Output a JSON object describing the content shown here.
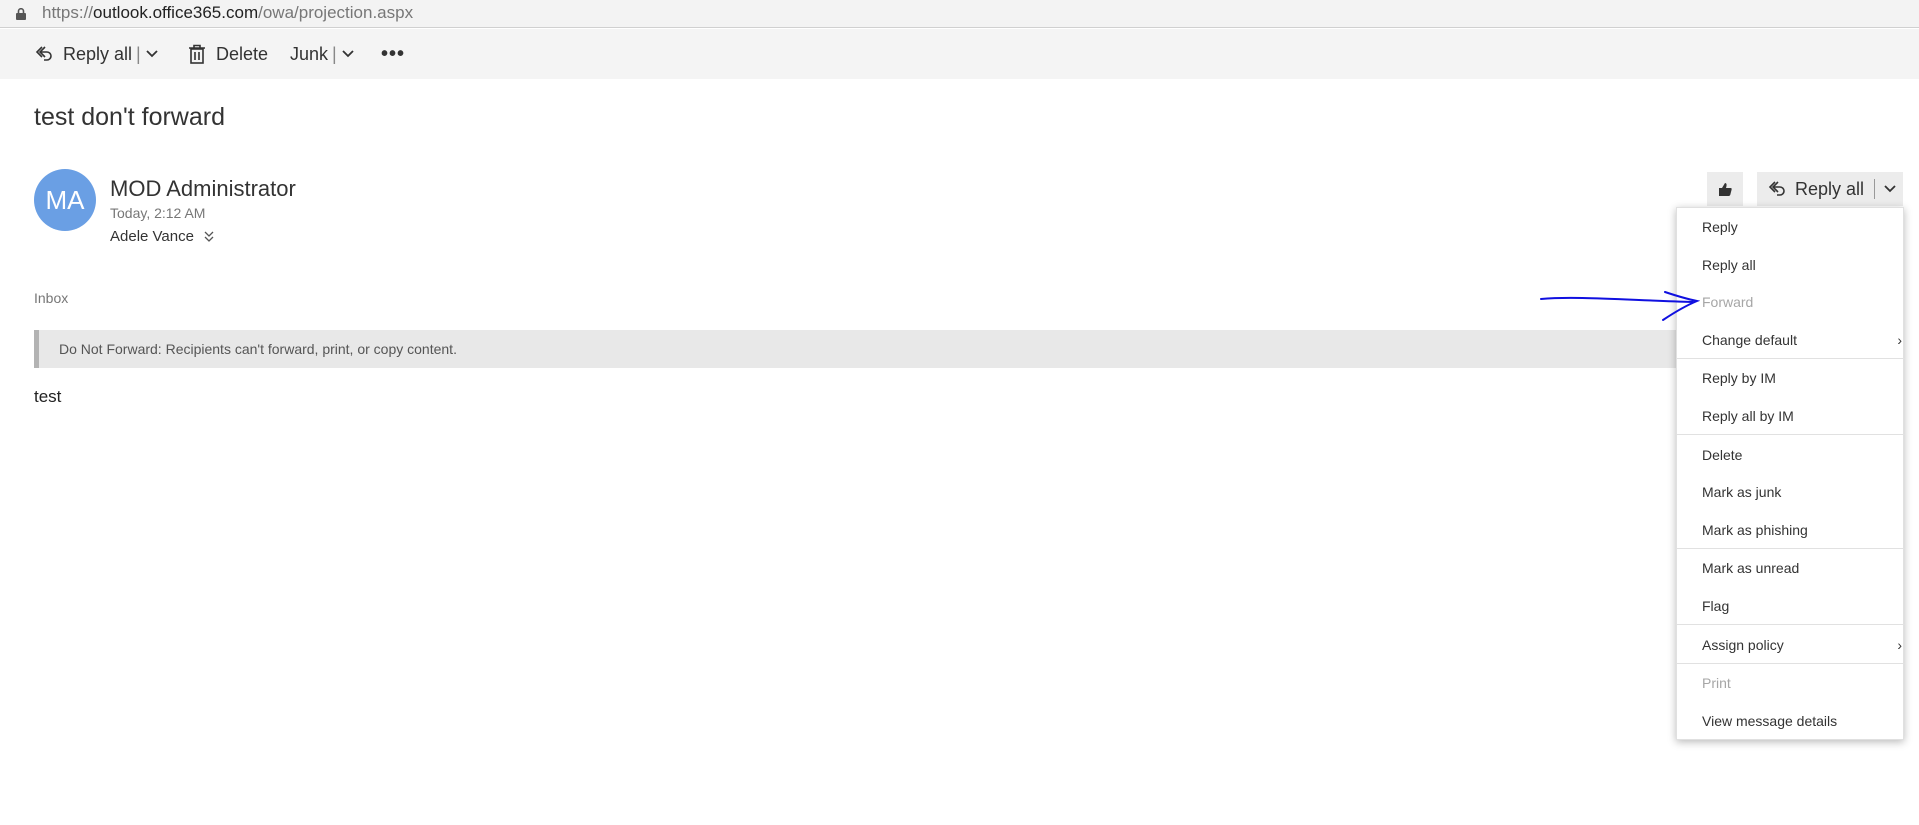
{
  "browser": {
    "url_scheme": "https://",
    "url_host": "outlook.office365.com",
    "url_path": "/owa/projection.aspx"
  },
  "toolbar": {
    "reply_all_label": "Reply all",
    "delete_label": "Delete",
    "junk_label": "Junk",
    "more_label": "•••"
  },
  "message": {
    "subject": "test don't forward",
    "avatar_initials": "MA",
    "avatar_color": "#6a9fe4",
    "sender": "MOD Administrator",
    "datetime": "Today, 2:12 AM",
    "recipient": "Adele Vance",
    "folder": "Inbox",
    "banner": "Do Not Forward: Recipients can't forward, print, or copy content.",
    "body": "test"
  },
  "header_actions": {
    "reply_all_label": "Reply all"
  },
  "menu": {
    "items": [
      {
        "label": "Reply",
        "disabled": false
      },
      {
        "label": "Reply all",
        "disabled": false
      },
      {
        "label": "Forward",
        "disabled": true
      },
      {
        "label": "Change default",
        "disabled": false,
        "submenu": true
      },
      {
        "label": "Reply by IM",
        "disabled": false
      },
      {
        "label": "Reply all by IM",
        "disabled": false
      },
      {
        "label": "Delete",
        "disabled": false
      },
      {
        "label": "Mark as junk",
        "disabled": false
      },
      {
        "label": "Mark as phishing",
        "disabled": false
      },
      {
        "label": "Mark as unread",
        "disabled": false
      },
      {
        "label": "Flag",
        "disabled": false
      },
      {
        "label": "Assign policy",
        "disabled": false,
        "submenu": true
      },
      {
        "label": "Print",
        "disabled": true
      },
      {
        "label": "View message details",
        "disabled": false
      }
    ]
  },
  "colors": {
    "annotation_arrow": "#1010e0",
    "disabled_text": "#a6a6a6"
  },
  "icons": {
    "lock": "lock-icon",
    "reply_all": "reply-all-icon",
    "delete": "trash-icon",
    "chevron": "chevron-down-icon",
    "like": "thumbs-up-icon",
    "expand_recipients": "double-chevron-down-icon",
    "submenu": "chevron-right-icon"
  }
}
